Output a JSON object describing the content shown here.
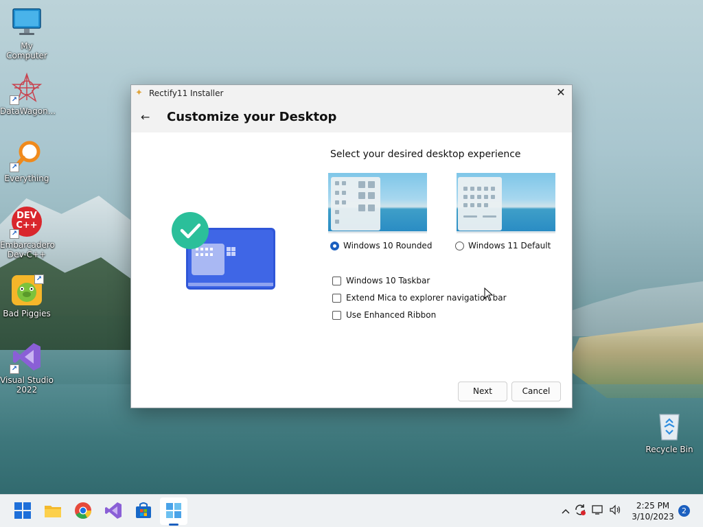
{
  "desktop": {
    "icons": [
      {
        "label": "My Computer"
      },
      {
        "label": "DataWagon..."
      },
      {
        "label": "Everything"
      },
      {
        "label": "Embarcadero Dev-C++"
      },
      {
        "label": "Bad Piggies"
      },
      {
        "label": "Visual Studio 2022"
      },
      {
        "label": "Recycle Bin"
      }
    ],
    "devcpp_logo_text": "DEV C++"
  },
  "window": {
    "title": "Rectify11 Installer",
    "close_glyph": "✕",
    "back_glyph": "←",
    "heading": "Customize your Desktop",
    "select_title": "Select your desired desktop experience",
    "options": [
      {
        "label": "Windows 10 Rounded",
        "selected": true
      },
      {
        "label": "Windows 11 Default",
        "selected": false
      }
    ],
    "checkboxes": [
      {
        "label": "Windows 10 Taskbar",
        "checked": false
      },
      {
        "label": "Extend Mica to explorer navigation bar",
        "checked": false
      },
      {
        "label": "Use Enhanced Ribbon",
        "checked": false
      }
    ],
    "buttons": {
      "next": "Next",
      "cancel": "Cancel"
    }
  },
  "taskbar": {
    "apps": [
      "start-icon",
      "file-explorer-icon",
      "chrome-icon",
      "visual-studio-icon",
      "store-icon",
      "rectify11-installer-icon"
    ],
    "time": "2:25 PM",
    "date": "3/10/2023",
    "notification_count": "2",
    "tray_chevron": "^"
  },
  "colors": {
    "accent": "#1b5fbf",
    "window_header": "#f2f2f2",
    "taskbar": "#eef1f3"
  }
}
